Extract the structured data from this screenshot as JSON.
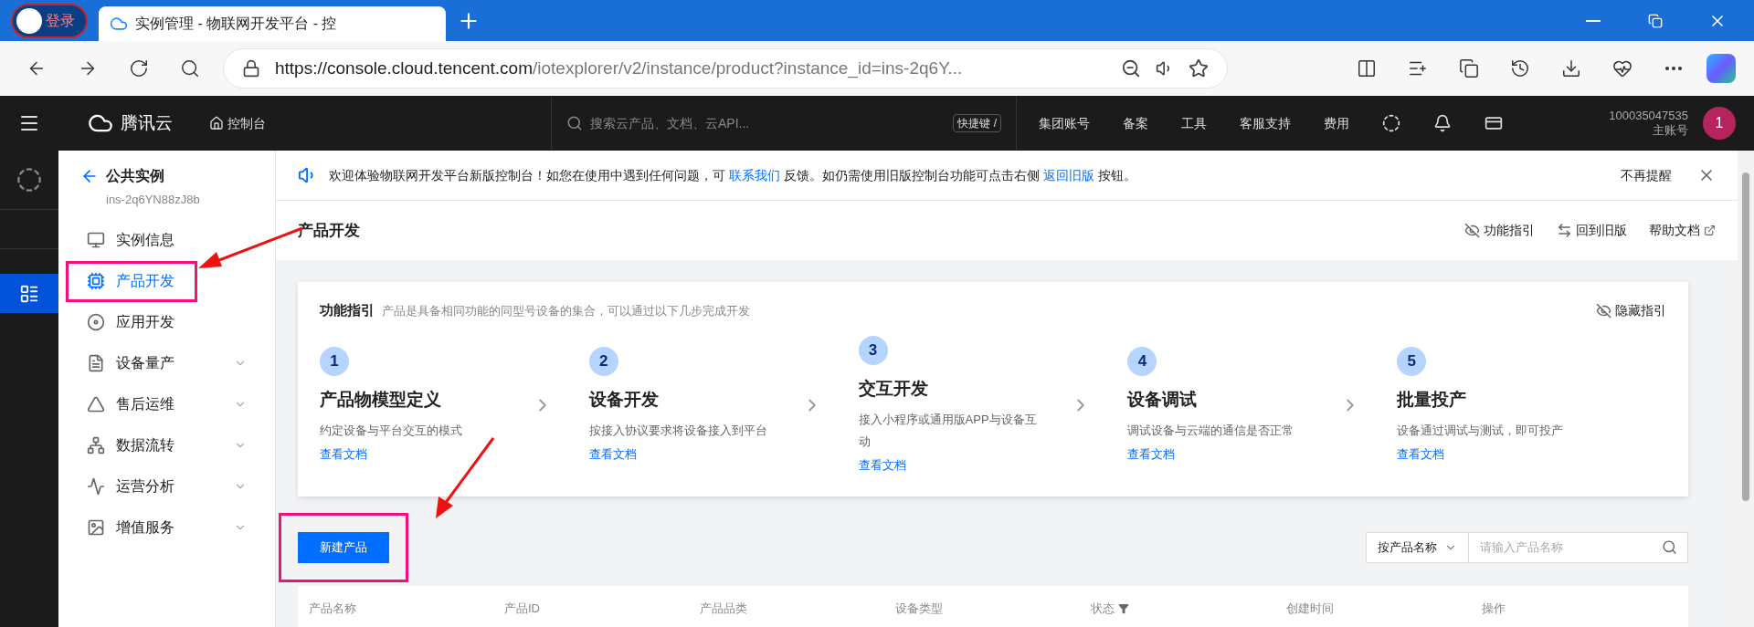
{
  "browser": {
    "profile": "登录",
    "tab_title": "实例管理 - 物联网开发平台 - 控",
    "url_host": "https://console.cloud.tencent.com",
    "url_path": "/iotexplorer/v2/instance/product?instance_id=ins-2q6Y..."
  },
  "topnav": {
    "brand": "腾讯云",
    "console": "控制台",
    "search_placeholder": "搜索云产品、文档、云API...",
    "shortcut": "快捷键 /",
    "links": [
      "集团账号",
      "备案",
      "工具",
      "客服支持",
      "费用"
    ],
    "account_id": "100035047535",
    "account_type": "主账号",
    "avatar": "1"
  },
  "sidebar": {
    "title": "公共实例",
    "instance_id": "ins-2q6YN88zJ8b",
    "items": [
      {
        "label": "实例信息",
        "selected": false,
        "expandable": false,
        "highlighted": false
      },
      {
        "label": "产品开发",
        "selected": true,
        "expandable": false,
        "highlighted": true
      },
      {
        "label": "应用开发",
        "selected": false,
        "expandable": false,
        "highlighted": false
      },
      {
        "label": "设备量产",
        "selected": false,
        "expandable": true,
        "highlighted": false
      },
      {
        "label": "售后运维",
        "selected": false,
        "expandable": true,
        "highlighted": false
      },
      {
        "label": "数据流转",
        "selected": false,
        "expandable": true,
        "highlighted": false
      },
      {
        "label": "运营分析",
        "selected": false,
        "expandable": true,
        "highlighted": false
      },
      {
        "label": "增值服务",
        "selected": false,
        "expandable": true,
        "highlighted": false
      }
    ]
  },
  "banner": {
    "parts": [
      {
        "kind": "text",
        "text": "欢迎体验物联网开发平台新版控制台！如您在使用中遇到任何问题，可 "
      },
      {
        "kind": "link",
        "text": "联系我们"
      },
      {
        "kind": "text",
        "text": " 反馈。如仍需使用旧版控制台功能可点击右侧 "
      },
      {
        "kind": "link",
        "text": "返回旧版"
      },
      {
        "kind": "text",
        "text": " 按钮。"
      }
    ],
    "dismiss": "不再提醒"
  },
  "page": {
    "title": "产品开发",
    "actions": [
      "功能指引",
      "回到旧版",
      "帮助文档"
    ]
  },
  "guide": {
    "title": "功能指引",
    "subtitle": "产品是具备相同功能的同型号设备的集合，可以通过以下几步完成开发",
    "hide": "隐藏指引",
    "steps": [
      {
        "number": "1",
        "title": "产品物模型定义",
        "desc": "约定设备与平台交互的模式",
        "link": "查看文档"
      },
      {
        "number": "2",
        "title": "设备开发",
        "desc": "按接入协议要求将设备接入到平台",
        "link": "查看文档"
      },
      {
        "number": "3",
        "title": "交互开发",
        "desc": "接入小程序或通用版APP与设备互动",
        "link": "查看文档"
      },
      {
        "number": "4",
        "title": "设备调试",
        "desc": "调试设备与云端的通信是否正常",
        "link": "查看文档"
      },
      {
        "number": "5",
        "title": "批量投产",
        "desc": "设备通过调试与测试，即可投产",
        "link": "查看文档"
      }
    ]
  },
  "toolbar": {
    "create": {
      "label": "新建产品",
      "highlighted": true
    },
    "filter": "按产品名称",
    "search_placeholder": "请输入产品名称"
  },
  "table": {
    "columns": [
      {
        "label": "产品名称",
        "filter": false
      },
      {
        "label": "产品ID",
        "filter": false
      },
      {
        "label": "产品品类",
        "filter": false
      },
      {
        "label": "设备类型",
        "filter": false
      },
      {
        "label": "状态",
        "filter": true
      },
      {
        "label": "创建时间",
        "filter": false
      },
      {
        "label": "操作",
        "filter": false
      }
    ]
  }
}
